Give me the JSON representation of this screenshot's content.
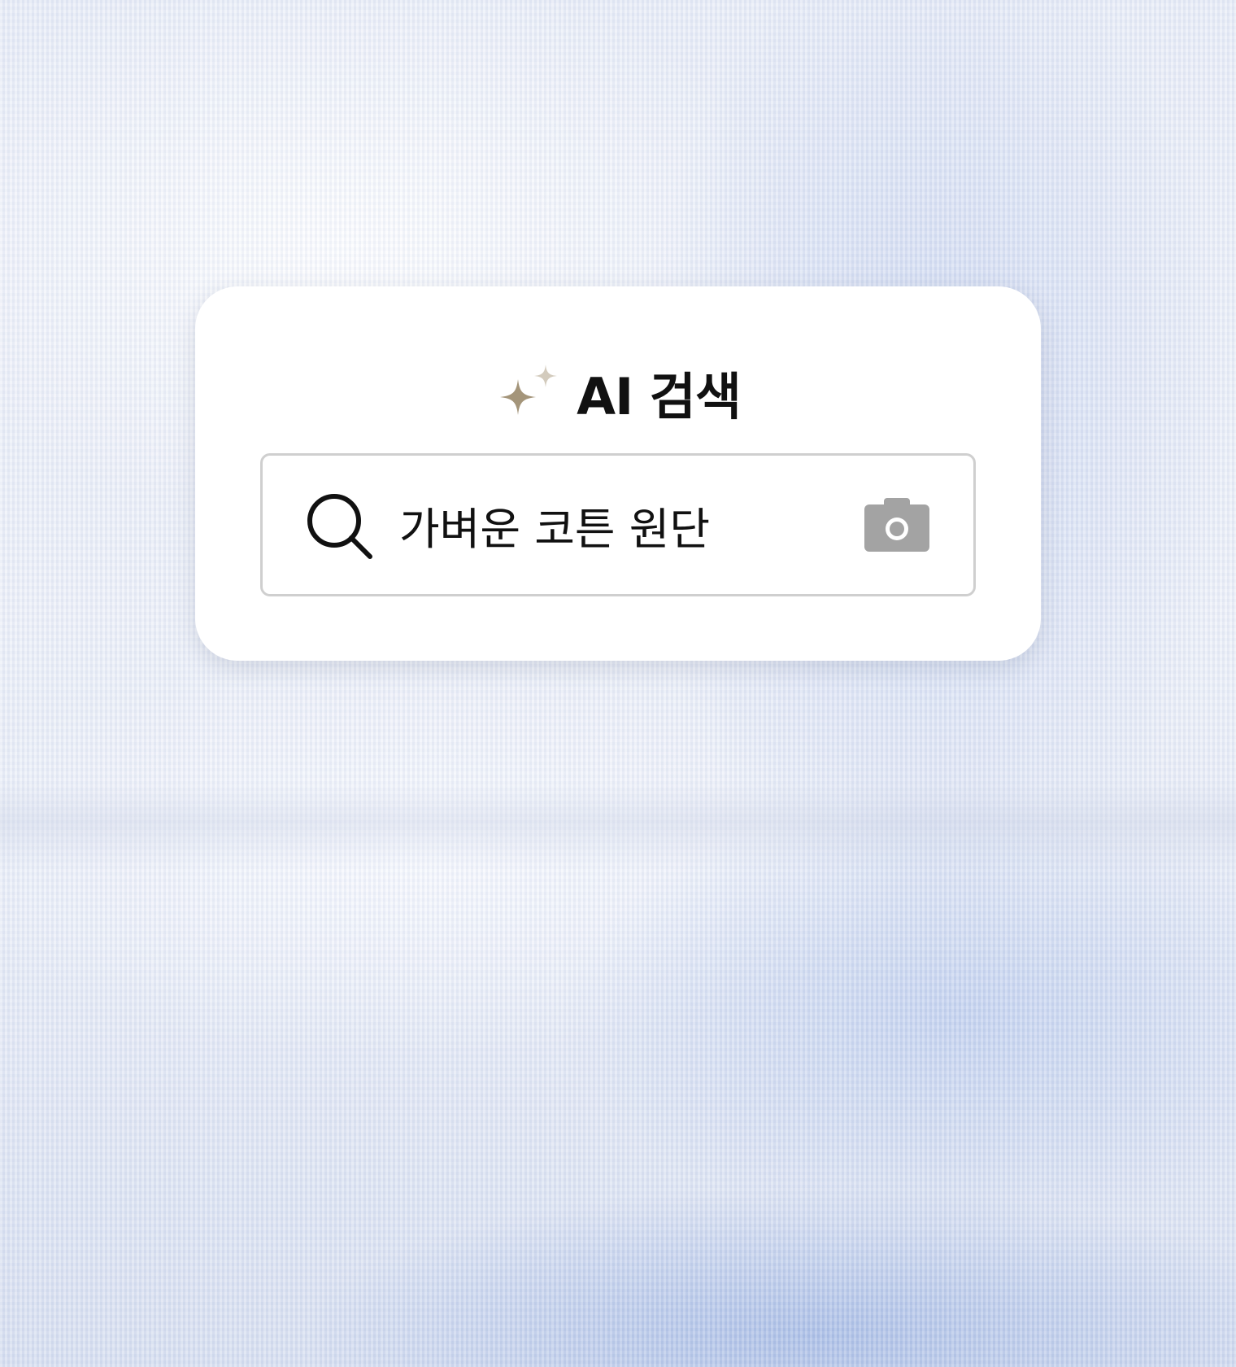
{
  "panel": {
    "title": "AI 검색",
    "title_icon": "sparkle-icon"
  },
  "search": {
    "query": "가벼운 코튼 원단",
    "leading_icon": "search-icon",
    "trailing_icon": "camera-icon"
  },
  "colors": {
    "sparkle_primary": "#a4957a",
    "sparkle_secondary": "#d3cbbd",
    "title_text": "#111111",
    "input_border": "#cfcfcf",
    "camera_icon": "#a3a3a3",
    "panel_background": "#ffffff"
  }
}
